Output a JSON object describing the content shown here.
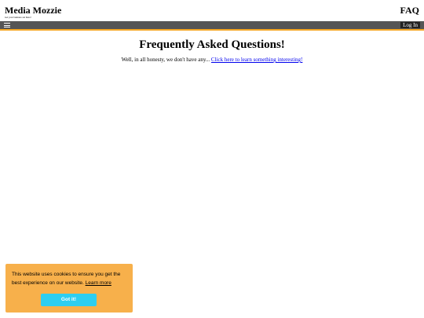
{
  "header": {
    "site_title": "Media Mozzie",
    "tagline": "Get your business out there!",
    "page_label": "FAQ"
  },
  "nav": {
    "menu_icon": "hamburger-menu-icon",
    "login_label": "Log In"
  },
  "main": {
    "heading": "Frequently Asked Questions!",
    "intro_text": "Well, in all honesty, we don't have any... ",
    "intro_link": "Click here to learn something interesting!"
  },
  "cookie_banner": {
    "message": "This website uses cookies to ensure you get the best experience on our website. ",
    "learn_more": "Learn more",
    "button_label": "Got it!"
  },
  "colors": {
    "nav_background": "#555555",
    "nav_accent": "#f5a623",
    "banner_background": "#f7b04b",
    "button_background": "#2ecef0",
    "link": "#0000ee"
  }
}
